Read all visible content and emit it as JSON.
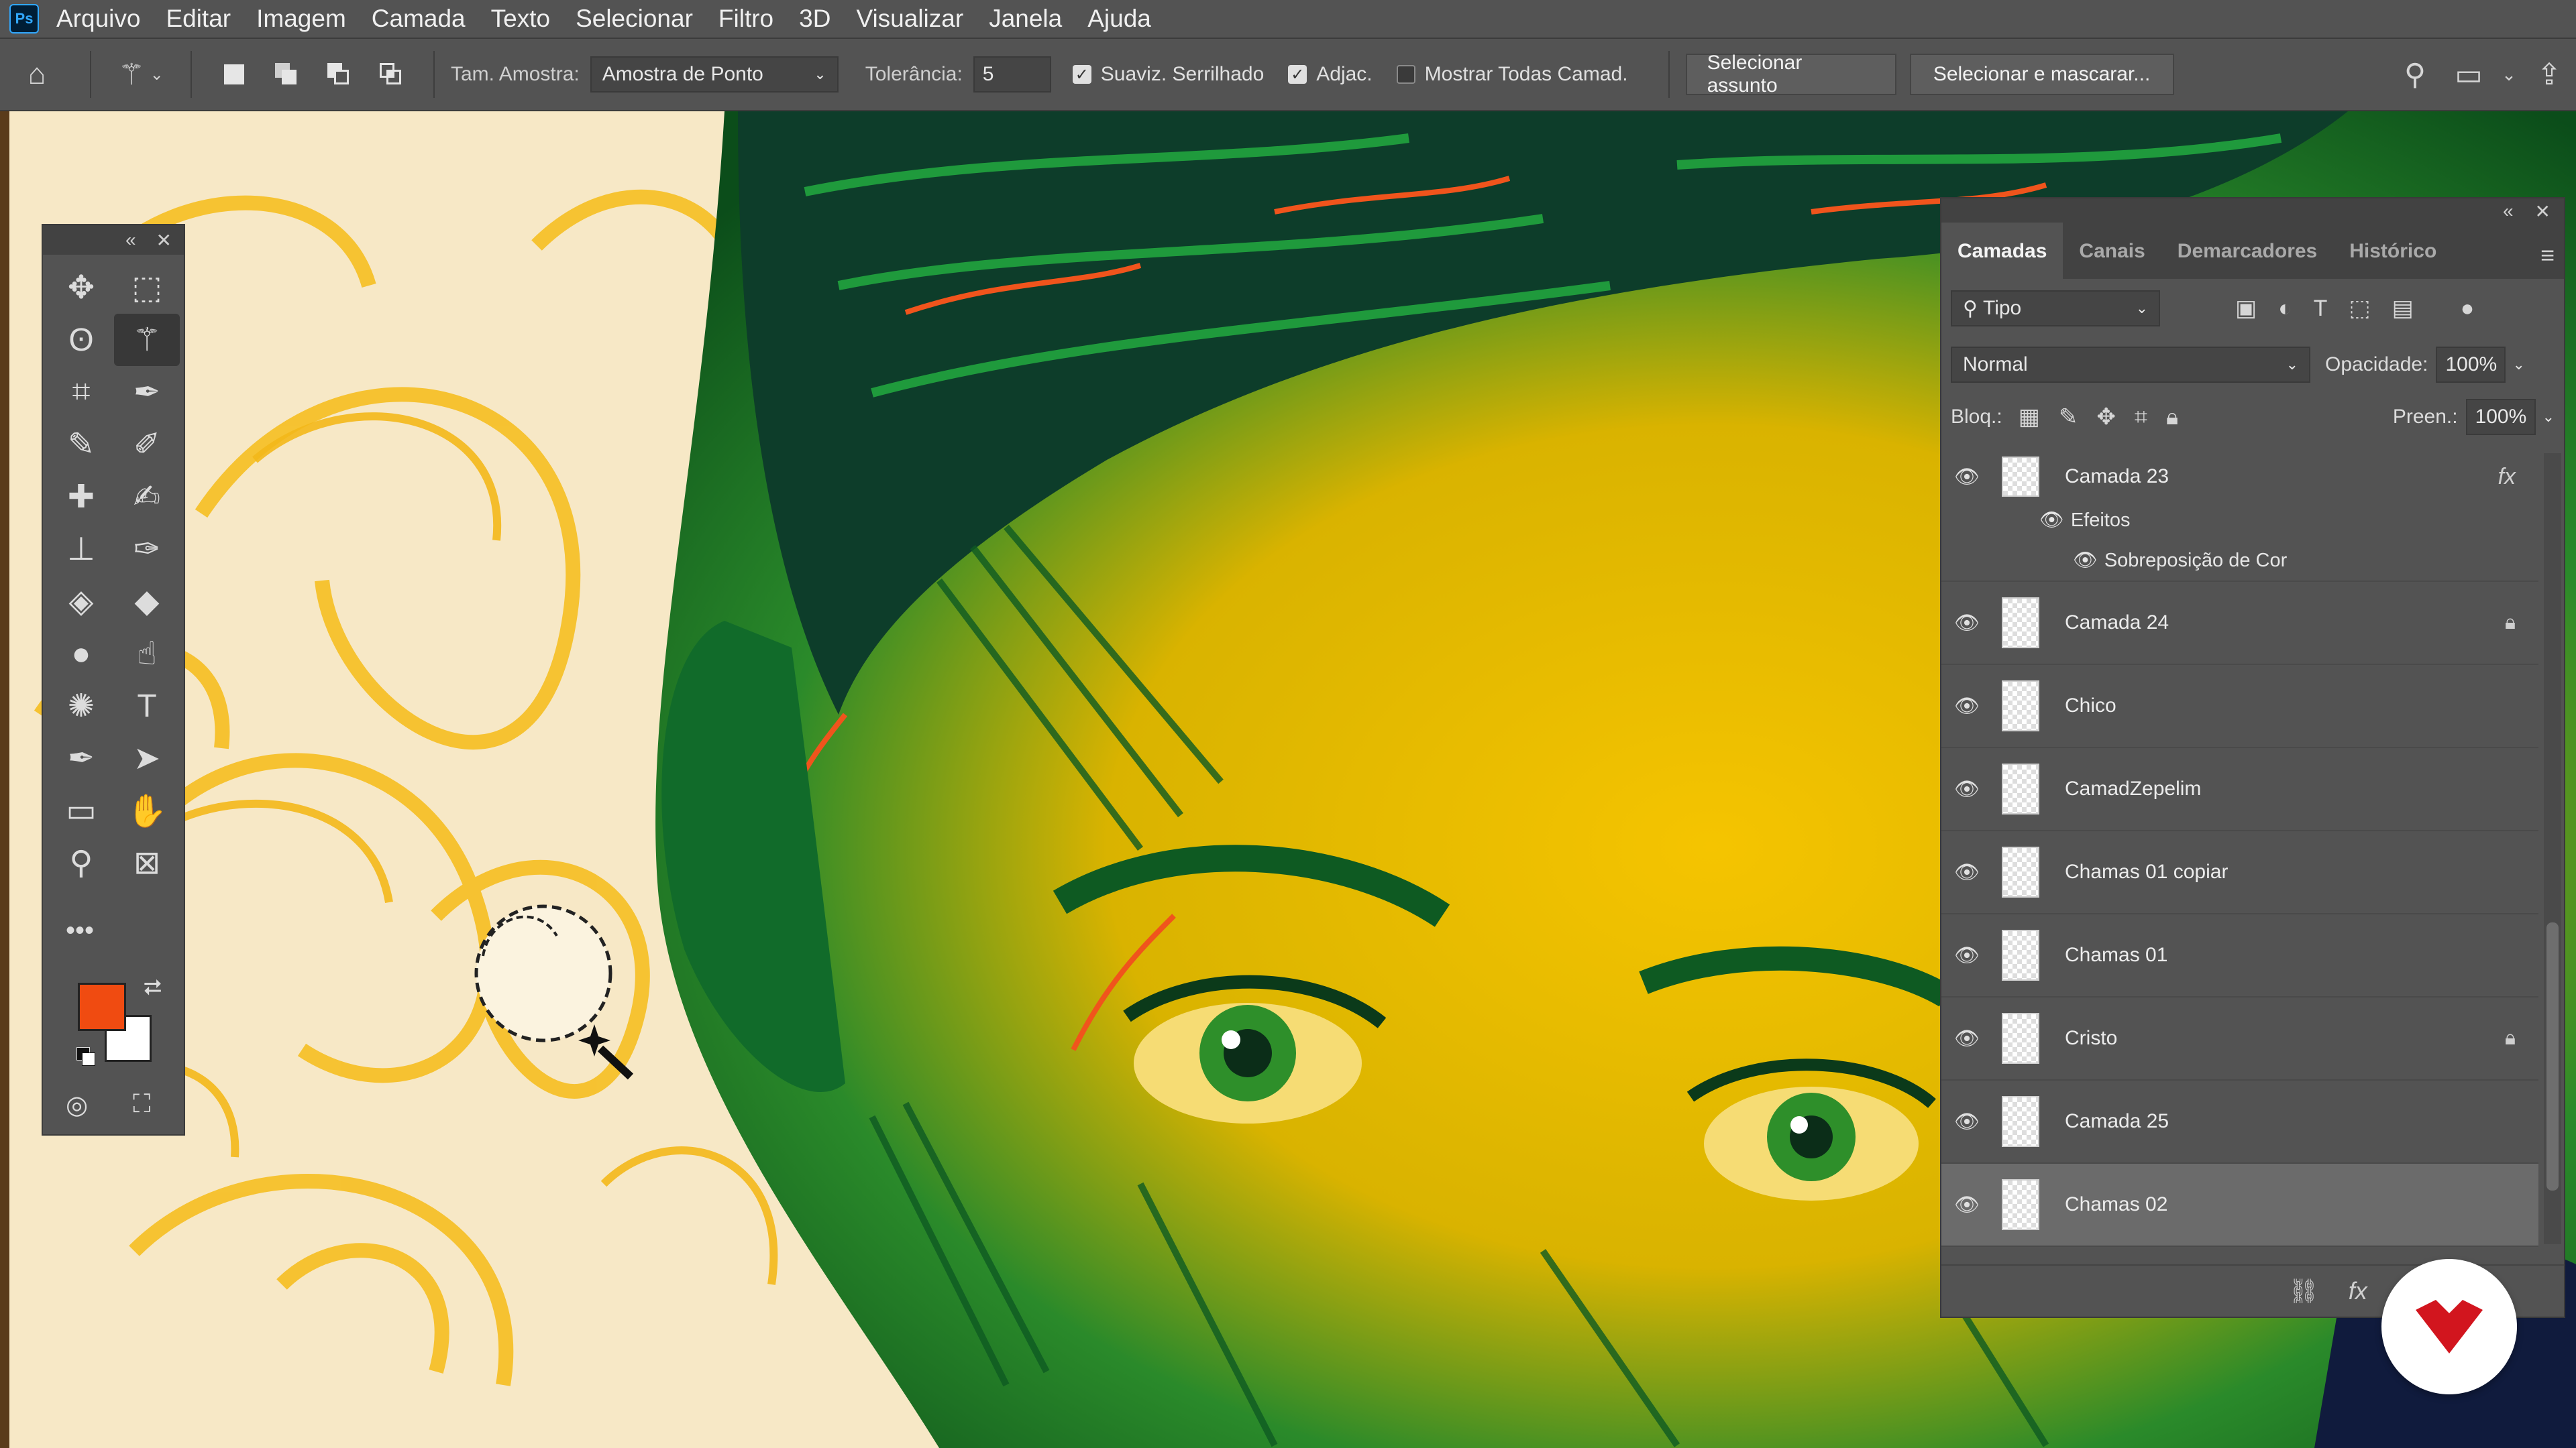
{
  "menubar": {
    "app_logo": "Ps",
    "items": [
      "Arquivo",
      "Editar",
      "Imagem",
      "Camada",
      "Texto",
      "Selecionar",
      "Filtro",
      "3D",
      "Visualizar",
      "Janela",
      "Ajuda"
    ]
  },
  "options": {
    "sample_size_label": "Tam. Amostra:",
    "sample_size_value": "Amostra de Ponto",
    "tolerance_label": "Tolerância:",
    "tolerance_value": "5",
    "antialias_label": "Suaviz. Serrilhado",
    "antialias_checked": true,
    "contiguous_label": "Adjac.",
    "contiguous_checked": true,
    "sample_all_label": "Mostrar Todas Camad.",
    "sample_all_checked": false,
    "select_subject_label": "Selecionar assunto",
    "select_mask_label": "Selecionar e mascarar..."
  },
  "tools": [
    {
      "name": "move-tool",
      "icon": "✥"
    },
    {
      "name": "marquee-tool",
      "icon": "⬚"
    },
    {
      "name": "lasso-tool",
      "icon": "ʘ"
    },
    {
      "name": "magic-wand-tool",
      "icon": "⚚",
      "active": true
    },
    {
      "name": "crop-tool",
      "icon": "⌗"
    },
    {
      "name": "eyedropper-tool",
      "icon": "✒"
    },
    {
      "name": "brush-tool",
      "icon": "✎"
    },
    {
      "name": "pencil-tool",
      "icon": "✐"
    },
    {
      "name": "healing-tool",
      "icon": "✚"
    },
    {
      "name": "history-brush-tool",
      "icon": "✍"
    },
    {
      "name": "stamp-tool",
      "icon": "⊥"
    },
    {
      "name": "mixer-brush-tool",
      "icon": "✑"
    },
    {
      "name": "eraser-tool",
      "icon": "◈"
    },
    {
      "name": "paint-bucket-tool",
      "icon": "◆"
    },
    {
      "name": "blur-tool",
      "icon": "●"
    },
    {
      "name": "smudge-tool",
      "icon": "☝"
    },
    {
      "name": "sponge-tool",
      "icon": "✺"
    },
    {
      "name": "type-tool",
      "icon": "T"
    },
    {
      "name": "pen-tool",
      "icon": "✒"
    },
    {
      "name": "path-select-tool",
      "icon": "➤"
    },
    {
      "name": "rectangle-tool",
      "icon": "▭"
    },
    {
      "name": "hand-tool",
      "icon": "✋"
    },
    {
      "name": "zoom-tool",
      "icon": "⚲"
    },
    {
      "name": "frame-tool",
      "icon": "⊠"
    }
  ],
  "colors": {
    "foreground": "#f04b11",
    "background": "#ffffff"
  },
  "layers_panel": {
    "tabs": [
      "Camadas",
      "Canais",
      "Demarcadores",
      "Histórico"
    ],
    "filter_label": "Tipo",
    "blend_mode": "Normal",
    "opacity_label": "Opacidade:",
    "opacity_value": "100%",
    "lock_label": "Bloq.:",
    "fill_label": "Preen.:",
    "fill_value": "100%",
    "effects_label": "Efeitos",
    "effect_name": "Sobreposição de Cor",
    "layers": [
      {
        "name": "Camada 23",
        "fx": true
      },
      {
        "name": "Camada 24",
        "locked": true
      },
      {
        "name": "Chico"
      },
      {
        "name": "CamadZepelim"
      },
      {
        "name": "Chamas 01 copiar"
      },
      {
        "name": "Chamas 01"
      },
      {
        "name": "Cristo",
        "locked": true
      },
      {
        "name": "Camada 25"
      },
      {
        "name": "Chamas 02",
        "selected": true
      }
    ]
  }
}
